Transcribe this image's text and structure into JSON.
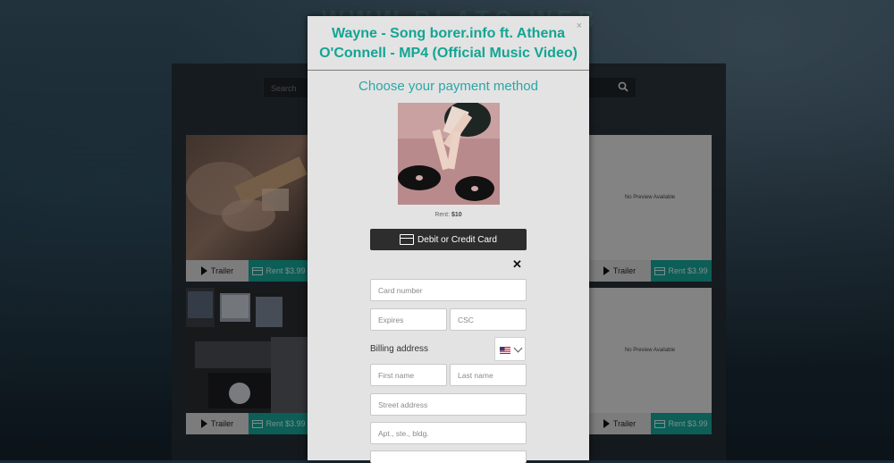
{
  "background": {
    "banner_text": "WWW.PLATO.WEB",
    "search_placeholder": "Search",
    "cards": [
      {
        "trailer_label": "Trailer",
        "rent_label": "Rent $3.99"
      },
      {
        "trailer_label": "Trailer",
        "rent_label": "Rent $3.99",
        "preview_text": "No Preview Available"
      },
      {
        "trailer_label": "Trailer",
        "rent_label": "Rent $3.99"
      },
      {
        "trailer_label": "Trailer",
        "rent_label": "Rent $3.99",
        "preview_text": "No Preview Available"
      }
    ]
  },
  "modal": {
    "close_label": "×",
    "title": "Wayne - Song borer.info ft. Athena O'Connell - MP4 (Official Music Video)",
    "heading": "Choose your payment method",
    "rent_prefix": "Rent: ",
    "rent_price": "$10",
    "pay_button_label": "Debit or Credit Card",
    "form_close_label": "✕",
    "card_number_placeholder": "Card number",
    "expires_placeholder": "Expires",
    "csc_placeholder": "CSC",
    "billing_label": "Billing address",
    "country_flag": "us-flag-icon",
    "first_name_placeholder": "First name",
    "last_name_placeholder": "Last name",
    "street_placeholder": "Street address",
    "apt_placeholder": "Apt., ste., bldg."
  },
  "colors": {
    "accent": "#12a594",
    "rent_button": "#16a394",
    "pay_button": "#2d2d2d"
  }
}
